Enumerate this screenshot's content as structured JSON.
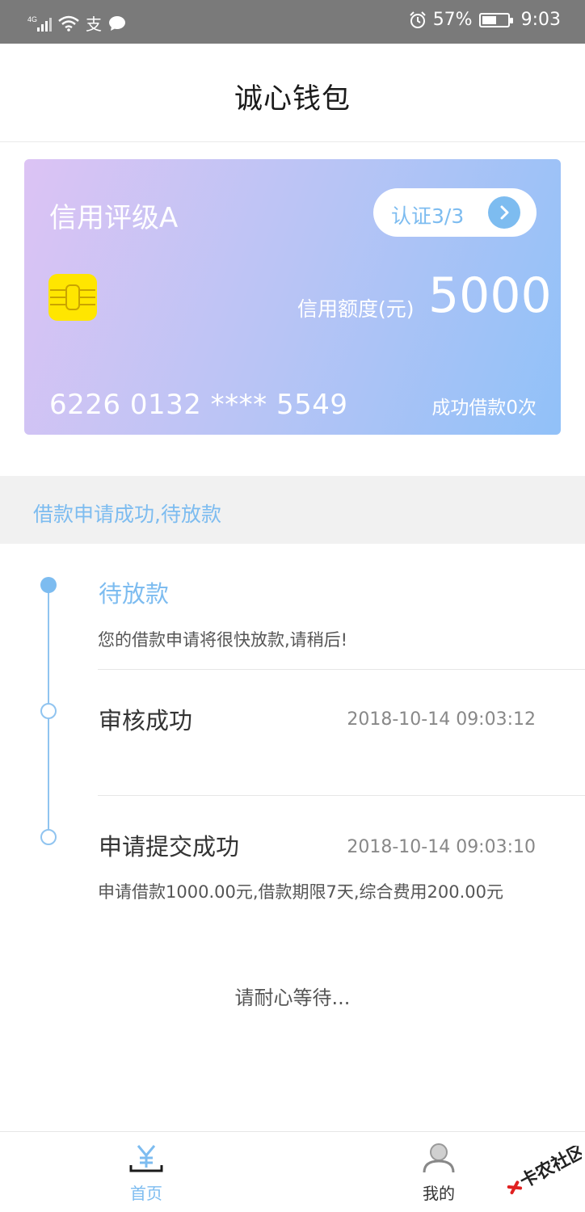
{
  "status_bar": {
    "network": "4G",
    "carrier_icon": "支",
    "battery_percent": "57%",
    "battery_level": 0.57,
    "time": "9:03"
  },
  "title": "诚心钱包",
  "card": {
    "credit_rating": "信用评级A",
    "verify_label": "认证3/3",
    "limit_label": "信用额度(元)",
    "limit_value": "5000",
    "card_number": "6226 0132 **** 5549",
    "success_count": "成功借款0次",
    "colors": {
      "gradient_start": "#dcc3f4",
      "gradient_end": "#91c1f8",
      "chip": "#ffe600"
    }
  },
  "status_banner": "借款申请成功,待放款",
  "timeline": [
    {
      "title": "待放款",
      "desc": "您的借款申请将很快放款,请稍后!",
      "time": "",
      "active": true
    },
    {
      "title": "审核成功",
      "desc": "",
      "time": "2018-10-14 09:03:12",
      "active": false
    },
    {
      "title": "申请提交成功",
      "desc": "申请借款1000.00元,借款期限7天,综合费用200.00元",
      "time": "2018-10-14 09:03:10",
      "active": false
    }
  ],
  "wait_text": "请耐心等待...",
  "nav": {
    "home": {
      "label": "首页",
      "icon": "yen-icon"
    },
    "mine": {
      "label": "我的",
      "icon": "user-icon"
    }
  },
  "watermark": "卡农社区",
  "accent_color": "#7dbcf0"
}
